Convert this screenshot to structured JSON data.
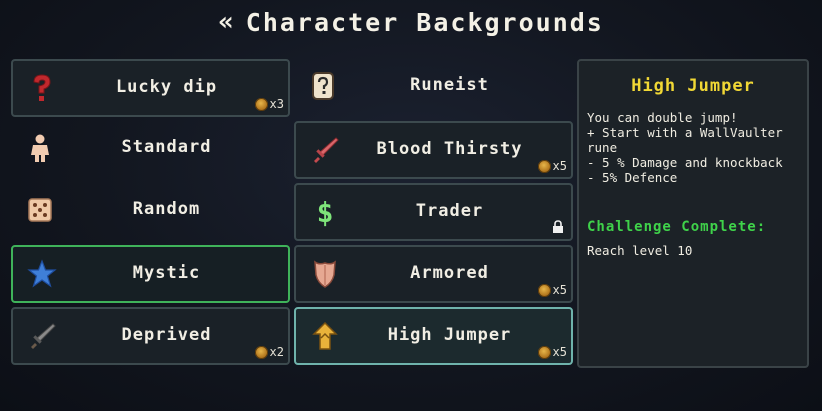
{
  "header": {
    "back_glyph": "«",
    "title": "Character Backgrounds"
  },
  "backgrounds_left": [
    {
      "label": "Lucky dip",
      "icon": "question-mark-icon",
      "cost": "x3"
    },
    {
      "label": "Standard",
      "icon": "person-icon"
    },
    {
      "label": "Random",
      "icon": "dice-icon"
    },
    {
      "label": "Mystic",
      "icon": "star-icon"
    },
    {
      "label": "Deprived",
      "icon": "sword-icon",
      "cost": "x2"
    }
  ],
  "backgrounds_right": [
    {
      "label": "Runeist",
      "icon": "rune-scroll-icon"
    },
    {
      "label": "Blood Thirsty",
      "icon": "bloody-sword-icon",
      "cost": "x5"
    },
    {
      "label": "Trader",
      "icon": "dollar-icon",
      "locked": true
    },
    {
      "label": "Armored",
      "icon": "shield-icon",
      "cost": "x5"
    },
    {
      "label": "High Jumper",
      "icon": "jump-arrow-icon",
      "cost": "x5"
    }
  ],
  "detail": {
    "title": "High Jumper",
    "description": "You can double jump!\n+ Start with a WallVaulter\nrune\n- 5 % Damage and knockback\n- 5% Defence",
    "challenge_label": "Challenge Complete:",
    "challenge_text": "Reach level 10"
  },
  "colors": {
    "accent_yellow": "#f1d835",
    "challenge_green": "#3fd24a",
    "selected_border": "#6fb3ac",
    "hover_border": "#3fb35a"
  }
}
